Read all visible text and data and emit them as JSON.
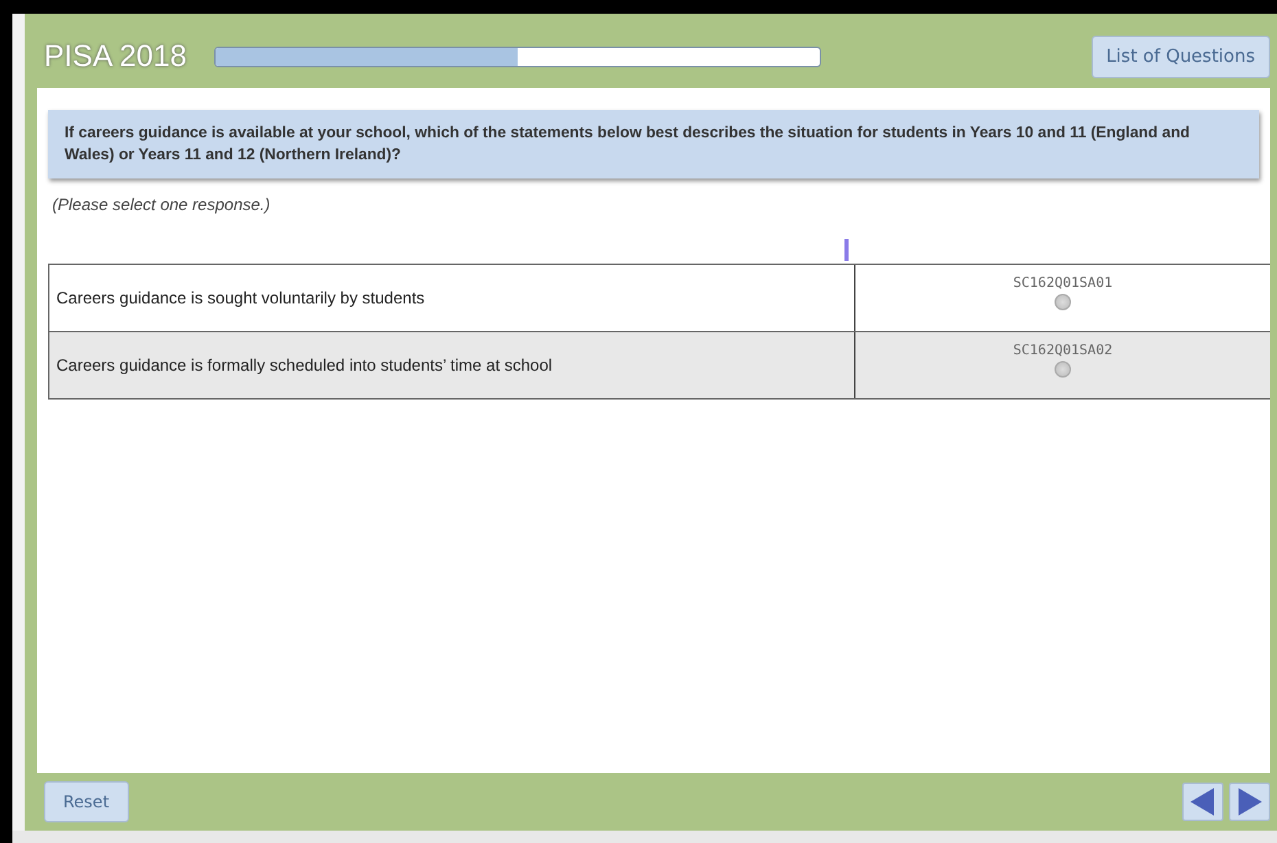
{
  "header": {
    "title": "PISA 2018",
    "progress": {
      "level": 0.5
    },
    "list_button": "List of Questions"
  },
  "question": "If careers guidance is available at your school, which of the statements below best describes the situation for students in Years 10 and 11 (England and Wales) or Years 11 and 12 (Northern Ireland)?",
  "instruction": "(Please select one response.)",
  "rows": [
    {
      "label": "Careers guidance is sought voluntarily by students",
      "code": "SC162Q01SA01",
      "selected": false
    },
    {
      "label": "Careers guidance is formally scheduled into students’ time at school",
      "code": "SC162Q01SA02",
      "selected": false
    }
  ],
  "footer": {
    "reset": "Reset"
  }
}
